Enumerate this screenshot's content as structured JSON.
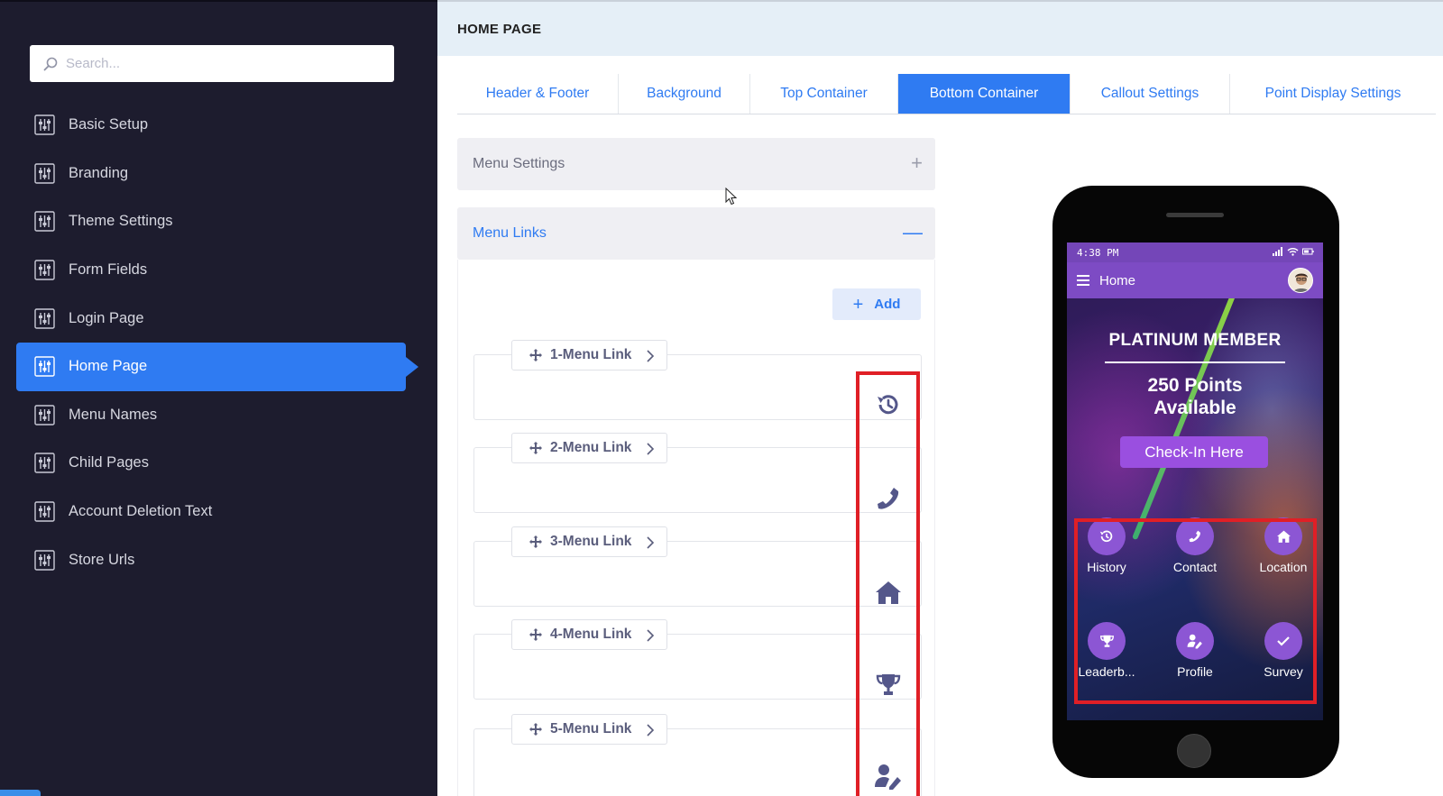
{
  "sidebar": {
    "search_placeholder": "Search...",
    "items": [
      {
        "label": "Basic Setup",
        "active": false
      },
      {
        "label": "Branding",
        "active": false
      },
      {
        "label": "Theme Settings",
        "active": false
      },
      {
        "label": "Form Fields",
        "active": false
      },
      {
        "label": "Login Page",
        "active": false
      },
      {
        "label": "Home Page",
        "active": true
      },
      {
        "label": "Menu Names",
        "active": false
      },
      {
        "label": "Child Pages",
        "active": false
      },
      {
        "label": "Account Deletion Text",
        "active": false
      },
      {
        "label": "Store Urls",
        "active": false
      }
    ]
  },
  "header": {
    "title": "HOME PAGE"
  },
  "tabs": [
    {
      "label": "Header & Footer",
      "active": false
    },
    {
      "label": "Background",
      "active": false
    },
    {
      "label": "Top Container",
      "active": false
    },
    {
      "label": "Bottom Container",
      "active": true
    },
    {
      "label": "Callout Settings",
      "active": false
    },
    {
      "label": "Point Display Settings",
      "active": false
    }
  ],
  "menu_settings": {
    "label": "Menu Settings",
    "toggle": "+"
  },
  "menu_links": {
    "label": "Menu Links",
    "toggle": "—",
    "add_label": "Add",
    "links": [
      {
        "label": "1-Menu Link",
        "icon": "history-icon"
      },
      {
        "label": "2-Menu Link",
        "icon": "phone-icon"
      },
      {
        "label": "3-Menu Link",
        "icon": "home-icon"
      },
      {
        "label": "4-Menu Link",
        "icon": "trophy-icon"
      },
      {
        "label": "5-Menu Link",
        "icon": "user-edit-icon"
      }
    ]
  },
  "phone": {
    "time": "4:38 PM",
    "app_title": "Home",
    "member_tier": "PLATINUM MEMBER",
    "points_line1": "250 Points",
    "points_line2": "Available",
    "checkin_label": "Check-In Here",
    "tiles": [
      {
        "label": "History",
        "icon": "history-icon"
      },
      {
        "label": "Contact",
        "icon": "phone-icon"
      },
      {
        "label": "Location",
        "icon": "home-icon"
      },
      {
        "label": "Leaderb...",
        "icon": "trophy-icon"
      },
      {
        "label": "Profile",
        "icon": "user-edit-icon"
      },
      {
        "label": "Survey",
        "icon": "check-icon"
      }
    ]
  },
  "colors": {
    "sidebar_bg": "#1d1c2e",
    "accent": "#2f7bf2",
    "header_bg": "#e5eff7",
    "highlight": "#e01f26",
    "phone_purple": "#7d4bc4"
  }
}
